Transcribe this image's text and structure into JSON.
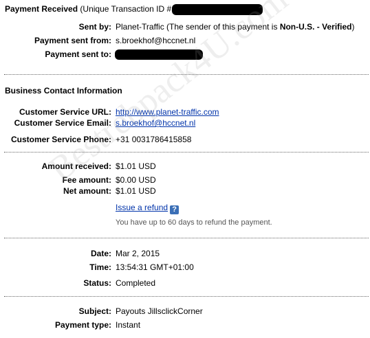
{
  "header": {
    "title_bold": "Payment Received",
    "title_rest": "(Unique Transaction ID #"
  },
  "sender": {
    "sent_by_label": "Sent by:",
    "sent_by_name": "Planet-Traffic",
    "sent_by_note_pre": "(The sender of this payment is",
    "sent_by_note_bold": "Non-U.S. - Verified",
    "sent_by_note_post": ")",
    "sent_from_label": "Payment sent from:",
    "sent_from_value": "s.broekhof@hccnet.nl",
    "sent_to_label": "Payment sent to:"
  },
  "business": {
    "heading": "Business Contact Information",
    "url_label": "Customer Service URL:",
    "url_value": "http://www.planet-traffic.com",
    "email_label": "Customer Service Email:",
    "email_value": "s.broekhof@hccnet.nl",
    "phone_label": "Customer Service Phone:",
    "phone_value": "+31 0031786415858"
  },
  "amounts": {
    "received_label": "Amount received:",
    "received_value": "$1.01 USD",
    "fee_label": "Fee amount:",
    "fee_value": "$0.00 USD",
    "net_label": "Net amount:",
    "net_value": "$1.01 USD",
    "refund_link": "Issue a refund",
    "help_icon_text": "?",
    "refund_note": "You have up to 60 days to refund the payment."
  },
  "details": {
    "date_label": "Date:",
    "date_value": "Mar 2, 2015",
    "time_label": "Time:",
    "time_value": "13:54:31 GMT+01:00",
    "status_label": "Status:",
    "status_value": "Completed"
  },
  "payment": {
    "subject_label": "Subject:",
    "subject_value": "Payouts JillsclickCorner",
    "type_label": "Payment type:",
    "type_value": "Instant"
  },
  "watermark": "Bestrebpack4U.com"
}
